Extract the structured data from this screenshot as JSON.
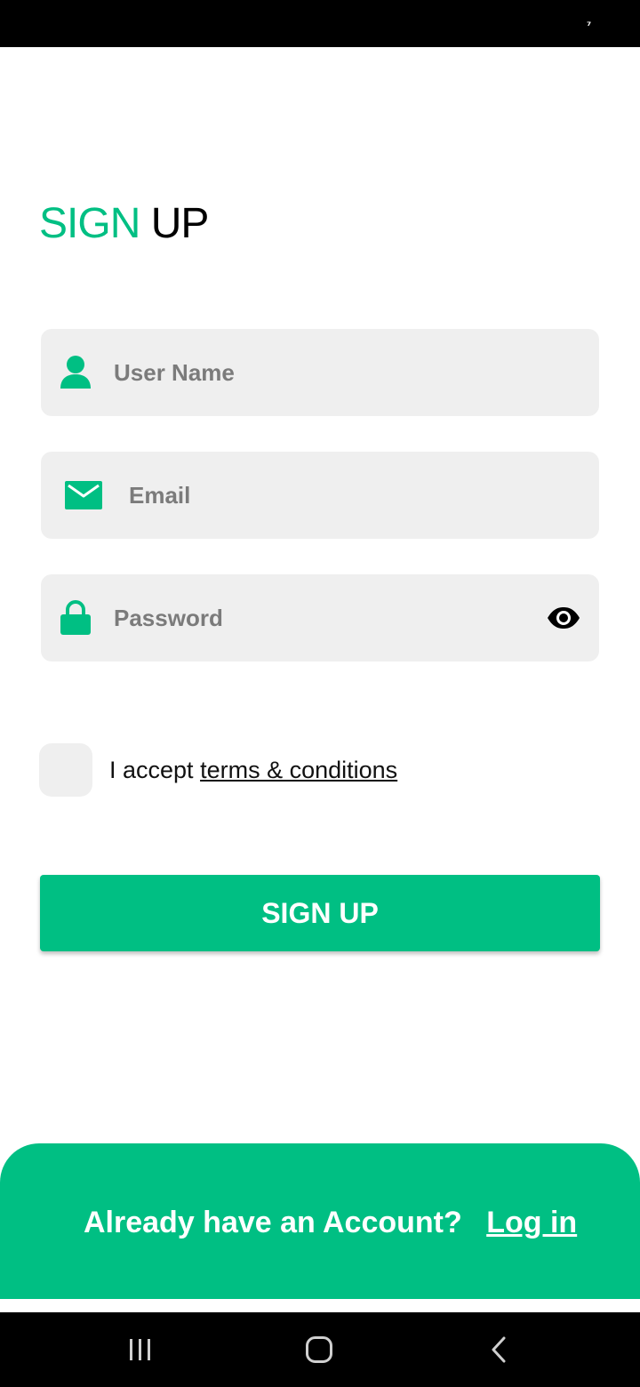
{
  "status_bar": {
    "glyph": "⁷"
  },
  "header": {
    "title_accent": "SIGN",
    "title_rest": "UP"
  },
  "form": {
    "username": {
      "placeholder": "User Name",
      "value": ""
    },
    "email": {
      "placeholder": "Email",
      "value": ""
    },
    "password": {
      "placeholder": "Password",
      "value": ""
    },
    "terms": {
      "prefix": "I accept",
      "link": "terms & conditions"
    },
    "submit_label": "SIGN UP"
  },
  "footer": {
    "question": "Already have an Account?",
    "login_label": "Log in"
  },
  "icons": {
    "username": "user-icon",
    "email": "mail-icon",
    "password": "lock-icon",
    "toggle": "eye-icon",
    "nav_recents": "recents-icon",
    "nav_home": "home-icon",
    "nav_back": "back-icon"
  },
  "colors": {
    "accent": "#00bf83",
    "field_bg": "#efefef",
    "text_muted": "#7b7b7b"
  }
}
